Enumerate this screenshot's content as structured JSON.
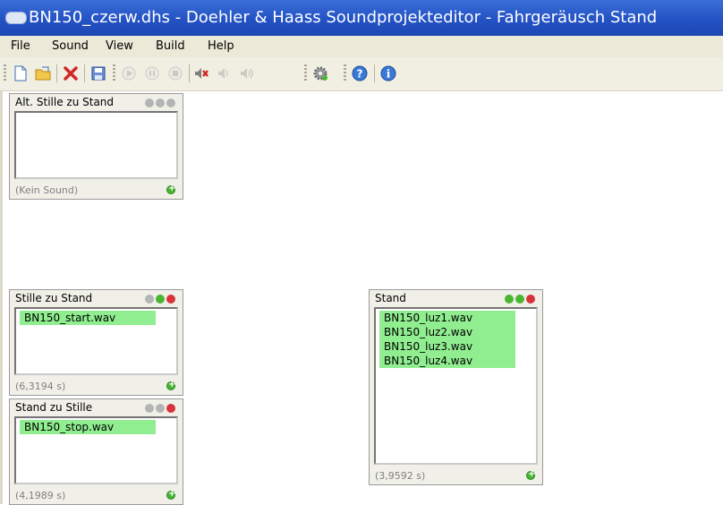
{
  "window": {
    "title": "BN150_czerw.dhs - Doehler & Haass Soundprojekteditor - Fahrgeräusch Stand"
  },
  "menu": [
    "File",
    "Sound",
    "View",
    "Build",
    "Help"
  ],
  "toolbar": {
    "buttons": [
      {
        "icon": "new-file-icon",
        "enabled": true
      },
      {
        "icon": "open-folder-icon",
        "enabled": true
      },
      {
        "icon": "delete-x-icon",
        "enabled": true
      },
      {
        "icon": "save-icon",
        "enabled": true
      },
      {
        "icon": "play-icon",
        "enabled": false
      },
      {
        "icon": "pause-icon",
        "enabled": false
      },
      {
        "icon": "stop-icon",
        "enabled": false
      },
      {
        "icon": "speaker-mute-icon",
        "enabled": true
      },
      {
        "icon": "speaker-low-icon",
        "enabled": false
      },
      {
        "icon": "speaker-high-icon",
        "enabled": false
      },
      {
        "icon": "build-gear-icon",
        "enabled": true
      },
      {
        "icon": "help-icon",
        "enabled": true
      },
      {
        "icon": "info-icon",
        "enabled": true
      }
    ]
  },
  "panels": [
    {
      "id": "alt-stille",
      "title": "Alt. Stille zu Stand",
      "items": [],
      "duration": "(Kein Sound)",
      "remove_enabled": false
    },
    {
      "id": "stille-zu-stand",
      "title": "Stille zu Stand",
      "items": [
        "BN150_start.wav"
      ],
      "duration": "(6,3194 s)",
      "remove_enabled": true
    },
    {
      "id": "stand-zu-stille",
      "title": "Stand zu Stille",
      "items": [
        "BN150_stop.wav"
      ],
      "duration": "(4,1989 s)",
      "remove_enabled": true
    },
    {
      "id": "stand",
      "title": "Stand",
      "items": [
        "BN150_luz1.wav",
        "BN150_luz2.wav",
        "BN150_luz3.wav",
        "BN150_luz4.wav"
      ],
      "duration": "(3,9592 s)",
      "remove_enabled": true
    }
  ],
  "colors": {
    "title_bar": "#2452c4",
    "list_item_highlight": "#90ee90",
    "add_green": "#45b432",
    "remove_red": "#d8323c"
  }
}
